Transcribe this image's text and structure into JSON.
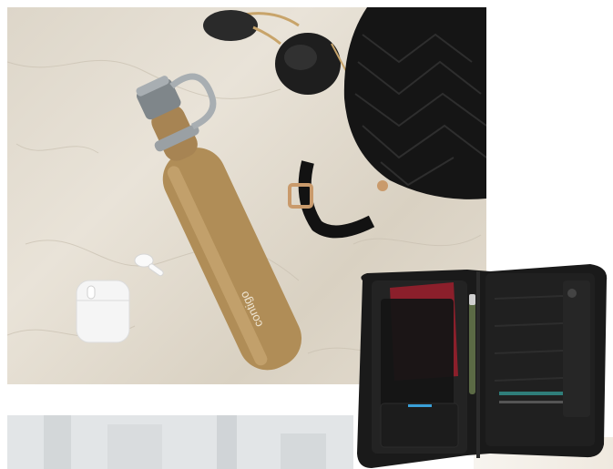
{
  "scene": {
    "bottle_brand": "contigo",
    "colors": {
      "marble": "#e3dccf",
      "bottle_gold": "#b08d57",
      "lid_gray": "#9aa0a4",
      "bag_black": "#141414",
      "organizer_black": "#1a1a1a",
      "passport_red": "#8b1f2b"
    }
  }
}
